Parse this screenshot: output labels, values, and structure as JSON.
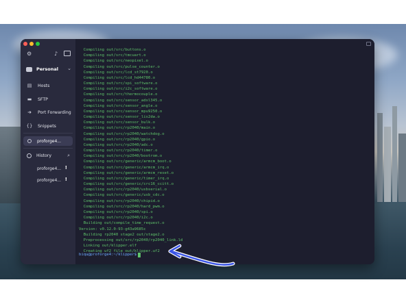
{
  "sidebar": {
    "vault_label": "Personal",
    "nav_items": [
      {
        "label": "Hosts",
        "icon": "hosts-icon"
      },
      {
        "label": "SFTP",
        "icon": "folder-icon"
      },
      {
        "label": "Port Forwarding",
        "icon": "port-forwarding-icon"
      },
      {
        "label": "Snippets",
        "icon": "snippets-icon"
      }
    ],
    "active_session": "proforge4...",
    "history_label": "History",
    "history_items": [
      {
        "label": "proforge4...",
        "badge": "!"
      },
      {
        "label": "proforge4...",
        "badge": "!"
      }
    ]
  },
  "terminal": {
    "lines": [
      "  Compiling out/src/buttons.o",
      "  Compiling out/src/tmcuart.o",
      "  Compiling out/src/neopixel.o",
      "  Compiling out/src/pulse_counter.o",
      "  Compiling out/src/lcd_st7920.o",
      "  Compiling out/src/lcd_hd44780.o",
      "  Compiling out/src/spi_software.o",
      "  Compiling out/src/i2c_software.o",
      "  Compiling out/src/thermocouple.o",
      "  Compiling out/src/sensor_adxl345.o",
      "  Compiling out/src/sensor_angle.o",
      "  Compiling out/src/sensor_mpu9250.o",
      "  Compiling out/src/sensor_lis2dw.o",
      "  Compiling out/src/sensor_bulk.o",
      "  Compiling out/src/rp2040/main.o",
      "  Compiling out/src/rp2040/watchdog.o",
      "  Compiling out/src/rp2040/gpio.o",
      "  Compiling out/src/rp2040/adc.o",
      "  Compiling out/src/rp2040/timer.o",
      "  Compiling out/src/rp2040/bootrom.o",
      "  Compiling out/src/generic/armcm_boot.o",
      "  Compiling out/src/generic/armcm_irq.o",
      "  Compiling out/src/generic/armcm_reset.o",
      "  Compiling out/src/generic/timer_irq.o",
      "  Compiling out/src/generic/crc16_ccitt.o",
      "  Compiling out/src/rp2040/usbserial.o",
      "  Compiling out/src/generic/usb_cdc.o",
      "  Compiling out/src/rp2040/chipid.o",
      "  Compiling out/src/rp2040/hard_pwm.o",
      "  Compiling out/src/rp2040/spi.o",
      "  Compiling out/src/rp2040/i2c.o",
      "  Building out/compile_time_request.o",
      "Version: v0.12.0-93-g43a9685c",
      "  Building rp2040 stage2 out/stage2.o",
      "  Preprocessing out/src/rp2040/rp2040_link.ld",
      "  Linking out/klipper.elf",
      "  Creating uf2 file out/klipper.uf2"
    ],
    "prompt": "biqu@proforge4:~/klipper$"
  },
  "colors": {
    "terminal_text": "#5fc36a",
    "prompt": "#6da8ff",
    "arrow": "#3b55e6",
    "sidebar_bg": "#292a3d",
    "terminal_bg": "#1d1e2e"
  }
}
